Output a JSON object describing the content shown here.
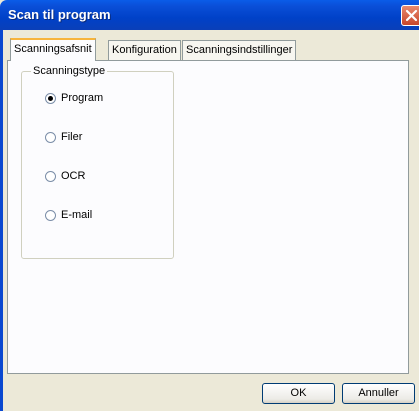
{
  "window": {
    "title": "Scan til program"
  },
  "tabs": [
    {
      "label": "Scanningsafsnit",
      "active": true
    },
    {
      "label": "Konfiguration",
      "active": false
    },
    {
      "label": "Scanningsindstillinger",
      "active": false
    }
  ],
  "scan_type": {
    "legend": "Scanningstype",
    "options": [
      {
        "label": "Program",
        "checked": true
      },
      {
        "label": "Filer",
        "checked": false
      },
      {
        "label": "OCR",
        "checked": false
      },
      {
        "label": "E-mail",
        "checked": false
      }
    ]
  },
  "buttons": {
    "ok": "OK",
    "cancel": "Annuller"
  },
  "colors": {
    "titlebar": "#0041c8",
    "dialog_face": "#ece9d8",
    "close_button": "#c8452a"
  }
}
